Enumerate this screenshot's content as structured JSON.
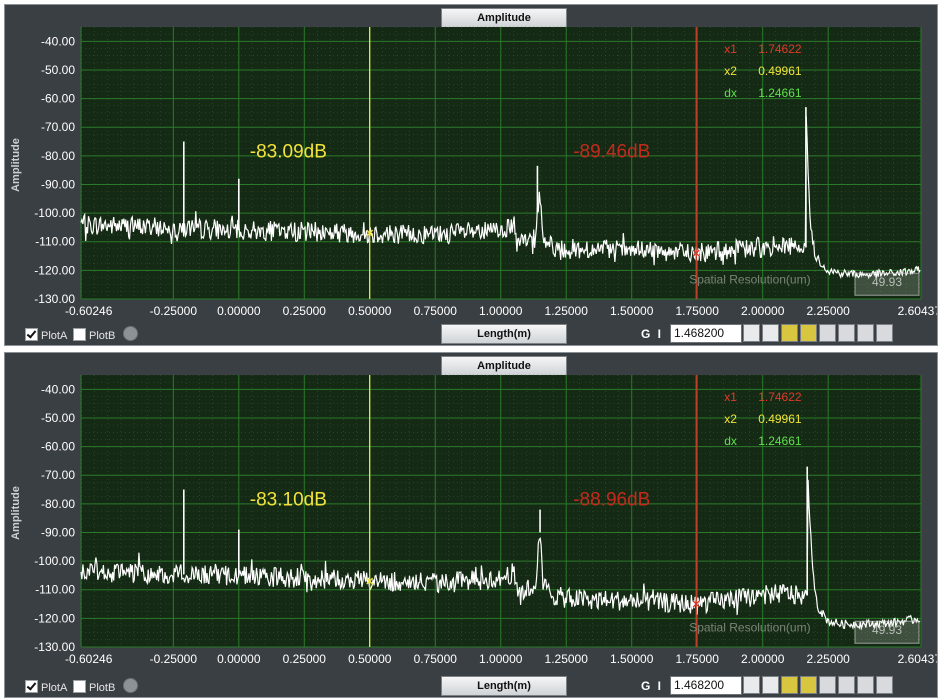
{
  "chart_data": [
    {
      "type": "line",
      "title": "Amplitude",
      "xlabel": "Length(m)",
      "ylabel": "Amplitude",
      "xlim": [
        -0.60246,
        2.60437
      ],
      "ylim": [
        -130,
        -35
      ],
      "y_ticks": [
        "-40.00",
        "-50.00",
        "-60.00",
        "-70.00",
        "-80.00",
        "-90.00",
        "-100.00",
        "-110.00",
        "-120.00",
        "-130.00"
      ],
      "y_tick_values": [
        -40,
        -50,
        -60,
        -70,
        -80,
        -90,
        -100,
        -110,
        -120,
        -130
      ],
      "x_ticks": [
        "-0.60246",
        "-0.25000",
        "0.00000",
        "0.25000",
        "0.50000",
        "0.75000",
        "1.00000",
        "1.25000",
        "1.50000",
        "1.75000",
        "2.00000",
        "2.25000",
        "2.60437"
      ],
      "x_tick_values": [
        -0.60246,
        -0.25,
        0,
        0.25,
        0.5,
        0.75,
        1.0,
        1.25,
        1.5,
        1.75,
        2.0,
        2.25,
        2.60437
      ],
      "grid": true,
      "series": [
        {
          "name": "PlotA",
          "color": "#ffffff"
        }
      ],
      "baseline": {
        "x": [
          -0.60246,
          -0.3,
          0.0,
          0.25,
          0.5,
          0.75,
          1.0,
          1.05,
          1.06,
          1.13,
          1.14,
          1.15,
          1.16,
          1.2,
          1.25,
          1.5,
          1.75,
          2.0,
          2.1,
          2.12
        ],
        "y": [
          -104,
          -105,
          -106,
          -106.5,
          -107,
          -107.5,
          -106,
          -104,
          -111,
          -109,
          -100,
          -93,
          -108,
          -112,
          -112.5,
          -113,
          -114,
          -112,
          -111,
          -112
        ]
      },
      "peaks": [
        {
          "x": -0.21,
          "y": -75
        },
        {
          "x": 0.0,
          "y": -88
        },
        {
          "x": 1.14,
          "y": -83.5
        },
        {
          "x": 2.165,
          "y": -63
        }
      ],
      "tail": {
        "x": [
          2.165,
          2.18,
          2.2,
          2.25,
          2.3,
          2.4,
          2.5,
          2.60437
        ],
        "y": [
          -63,
          -102,
          -115,
          -120,
          -121,
          -121.5,
          -121,
          -120
        ]
      },
      "cursors": [
        {
          "name": "x2",
          "x": 0.49961,
          "color": "#f2e33c",
          "annotation": "-83.09dB",
          "annotation_color": "#f2e33c"
        },
        {
          "name": "x1",
          "x": 1.74622,
          "color": "#d63a2a",
          "annotation": "-89.46dB",
          "annotation_color": "#c42a1c"
        }
      ],
      "readout": [
        {
          "label": "x1",
          "value": "1.74622",
          "color": "#e03a2a"
        },
        {
          "label": "x2",
          "value": "0.49961",
          "color": "#f2e33c"
        },
        {
          "label": "dx",
          "value": "1.24661",
          "color": "#5fe04a"
        }
      ],
      "spatial_resolution_label": "Spatial Resolution(um)",
      "spatial_resolution_value": "49.93"
    },
    {
      "type": "line",
      "title": "Amplitude",
      "xlabel": "Length(m)",
      "ylabel": "Amplitude",
      "xlim": [
        -0.60246,
        2.60437
      ],
      "ylim": [
        -130,
        -35
      ],
      "y_ticks": [
        "-40.00",
        "-50.00",
        "-60.00",
        "-70.00",
        "-80.00",
        "-90.00",
        "-100.00",
        "-110.00",
        "-120.00",
        "-130.00"
      ],
      "y_tick_values": [
        -40,
        -50,
        -60,
        -70,
        -80,
        -90,
        -100,
        -110,
        -120,
        -130
      ],
      "x_ticks": [
        "-0.60246",
        "-0.25000",
        "0.00000",
        "0.25000",
        "0.50000",
        "0.75000",
        "1.00000",
        "1.25000",
        "1.50000",
        "1.75000",
        "2.00000",
        "2.25000",
        "2.60437"
      ],
      "x_tick_values": [
        -0.60246,
        -0.25,
        0,
        0.25,
        0.5,
        0.75,
        1.0,
        1.25,
        1.5,
        1.75,
        2.0,
        2.25,
        2.60437
      ],
      "grid": true,
      "series": [
        {
          "name": "PlotA",
          "color": "#ffffff"
        }
      ],
      "baseline": {
        "x": [
          -0.60246,
          -0.3,
          0.0,
          0.25,
          0.5,
          0.75,
          1.0,
          1.05,
          1.06,
          1.13,
          1.14,
          1.15,
          1.16,
          1.2,
          1.25,
          1.5,
          1.75,
          2.0,
          2.1,
          2.12
        ],
        "y": [
          -104,
          -104.5,
          -105,
          -106,
          -107,
          -107.5,
          -106,
          -104,
          -111,
          -109,
          -100,
          -90,
          -108,
          -112,
          -113,
          -114,
          -115,
          -112,
          -111,
          -112
        ]
      },
      "peaks": [
        {
          "x": -0.21,
          "y": -75
        },
        {
          "x": 0.0,
          "y": -89
        },
        {
          "x": 1.15,
          "y": -82
        },
        {
          "x": 2.17,
          "y": -67
        }
      ],
      "tail": {
        "x": [
          2.17,
          2.19,
          2.21,
          2.25,
          2.3,
          2.4,
          2.5,
          2.60437
        ],
        "y": [
          -67,
          -103,
          -116,
          -121,
          -122,
          -122,
          -121.5,
          -120
        ]
      },
      "cursors": [
        {
          "name": "x2",
          "x": 0.49961,
          "color": "#f2e33c",
          "annotation": "-83.10dB",
          "annotation_color": "#f2e33c"
        },
        {
          "name": "x1",
          "x": 1.74622,
          "color": "#d63a2a",
          "annotation": "-88.96dB",
          "annotation_color": "#c42a1c"
        }
      ],
      "readout": [
        {
          "label": "x1",
          "value": "1.74622",
          "color": "#e03a2a"
        },
        {
          "label": "x2",
          "value": "0.49961",
          "color": "#f2e33c"
        },
        {
          "label": "dx",
          "value": "1.24661",
          "color": "#5fe04a"
        }
      ],
      "spatial_resolution_label": "Spatial Resolution(um)",
      "spatial_resolution_value": "49.93"
    }
  ],
  "panels": [
    {
      "plot_a_label": "PlotA",
      "plot_b_label": "PlotB",
      "plot_a_checked": true,
      "plot_b_checked": false,
      "gi_label": "G I",
      "value_field": "1.468200"
    },
    {
      "plot_a_label": "PlotA",
      "plot_b_label": "PlotB",
      "plot_a_checked": true,
      "plot_b_checked": false,
      "gi_label": "G I",
      "value_field": "1.468200"
    }
  ],
  "toolbar_icons": [
    "cursor-line-icon",
    "cursor-peak-icon",
    "cursor-triangle-icon",
    "cursor-lock-icon",
    "marker-icon",
    "crosshair-icon",
    "zoom-icon",
    "pan-hand-icon"
  ],
  "colors": {
    "plot_bg": "#152a15",
    "grid_major": "#2b7a2b",
    "grid_minor": "#3b5a3b",
    "panel_bg": "#3a3f44"
  }
}
